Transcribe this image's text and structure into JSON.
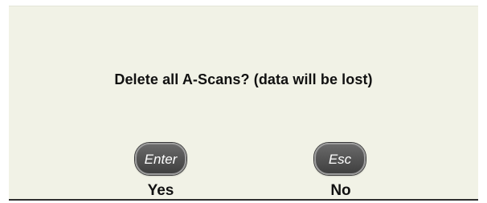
{
  "dialog": {
    "message": "Delete all A-Scans? (data will be lost)",
    "confirm": {
      "key_label": "Enter",
      "caption": "Yes"
    },
    "cancel": {
      "key_label": "Esc",
      "caption": "No"
    }
  }
}
